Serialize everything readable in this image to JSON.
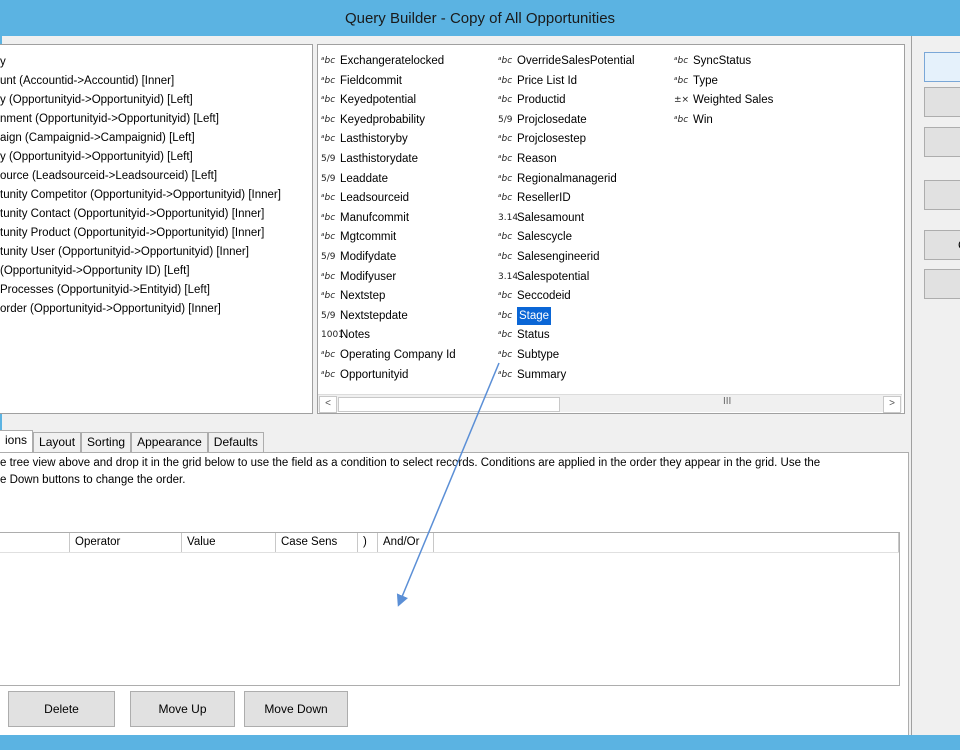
{
  "window": {
    "title": "Query Builder - Copy of All Opportunities"
  },
  "tree": {
    "items": [
      "y",
      "unt (Accountid->Accountid) [Inner]",
      "y (Opportunityid->Opportunityid) [Left]",
      "nment (Opportunityid->Opportunityid) [Left]",
      "aign (Campaignid->Campaignid) [Left]",
      "y (Opportunityid->Opportunityid) [Left]",
      "ource (Leadsourceid->Leadsourceid) [Left]",
      "tunity Competitor (Opportunityid->Opportunityid) [Inner]",
      "tunity Contact (Opportunityid->Opportunityid) [Inner]",
      "tunity Product (Opportunityid->Opportunityid) [Inner]",
      "tunity User (Opportunityid->Opportunityid) [Inner]",
      "(Opportunityid->Opportunity ID) [Left]",
      "Processes (Opportunityid->Entityid) [Left]",
      "order (Opportunityid->Opportunityid) [Inner]"
    ]
  },
  "fields": {
    "columns": [
      [
        {
          "icon": "abc",
          "label": "Exchangeratelocked"
        },
        {
          "icon": "abc",
          "label": "Fieldcommit"
        },
        {
          "icon": "abc",
          "label": "Keyedpotential"
        },
        {
          "icon": "abc",
          "label": "Keyedprobability"
        },
        {
          "icon": "abc",
          "label": "Lasthistoryby"
        },
        {
          "icon": "date",
          "label": "Lasthistorydate"
        },
        {
          "icon": "date",
          "label": "Leaddate"
        },
        {
          "icon": "abc",
          "label": "Leadsourceid"
        },
        {
          "icon": "abc",
          "label": "Manufcommit"
        },
        {
          "icon": "abc",
          "label": "Mgtcommit"
        },
        {
          "icon": "date",
          "label": "Modifydate"
        },
        {
          "icon": "abc",
          "label": "Modifyuser"
        },
        {
          "icon": "abc",
          "label": "Nextstep"
        },
        {
          "icon": "date",
          "label": "Nextstepdate"
        },
        {
          "icon": "memo",
          "label": "Notes"
        },
        {
          "icon": "abc",
          "label": "Operating Company Id"
        },
        {
          "icon": "abc",
          "label": "Opportunityid"
        }
      ],
      [
        {
          "icon": "abc",
          "label": "OverrideSalesPotential"
        },
        {
          "icon": "abc",
          "label": "Price List Id"
        },
        {
          "icon": "abc",
          "label": "Productid"
        },
        {
          "icon": "date",
          "label": "Projclosedate"
        },
        {
          "icon": "abc",
          "label": "Projclosestep"
        },
        {
          "icon": "abc",
          "label": "Reason"
        },
        {
          "icon": "abc",
          "label": "Regionalmanagerid"
        },
        {
          "icon": "abc",
          "label": "ResellerID"
        },
        {
          "icon": "num",
          "label": "Salesamount"
        },
        {
          "icon": "abc",
          "label": "Salescycle"
        },
        {
          "icon": "abc",
          "label": "Salesengineerid"
        },
        {
          "icon": "num",
          "label": "Salespotential"
        },
        {
          "icon": "abc",
          "label": "Seccodeid"
        },
        {
          "icon": "abc",
          "label": "Stage"
        },
        {
          "icon": "abc",
          "label": "Status"
        },
        {
          "icon": "abc",
          "label": "Subtype"
        },
        {
          "icon": "abc",
          "label": "Summary"
        }
      ],
      [
        {
          "icon": "abc",
          "label": "SyncStatus"
        },
        {
          "icon": "abc",
          "label": "Type"
        },
        {
          "icon": "calc",
          "label": "Weighted Sales"
        },
        {
          "icon": "abc",
          "label": "Win"
        }
      ]
    ],
    "selected": "Stage",
    "icon_glyphs": {
      "abc": "ᵃbc",
      "date": "5/9",
      "num": "3.14",
      "memo": "1001",
      "calc": "±×"
    },
    "scroll_grip": "III"
  },
  "side_buttons": [
    "",
    "",
    "",
    "",
    "C",
    ""
  ],
  "tabs": [
    {
      "label": "ions",
      "active": true
    },
    {
      "label": "Layout",
      "active": false
    },
    {
      "label": "Sorting",
      "active": false
    },
    {
      "label": "Appearance",
      "active": false
    },
    {
      "label": "Defaults",
      "active": false
    }
  ],
  "instructions": {
    "line1": "e tree view above and drop it in the grid below to use the field as a condition to select records.  Conditions are applied in the order they appear in the grid.  Use the",
    "line2": "e Down buttons to change the order."
  },
  "grid": {
    "columns": [
      "",
      "Operator",
      "Value",
      "Case Sens",
      ")",
      "And/Or",
      ""
    ]
  },
  "bottom_buttons": {
    "delete": "Delete",
    "move_up": "Move Up",
    "move_down": "Move Down"
  },
  "colors": {
    "frame": "#5bb3e2",
    "selection": "#0a66d6",
    "drag_arrow": "#5b8fd6"
  }
}
